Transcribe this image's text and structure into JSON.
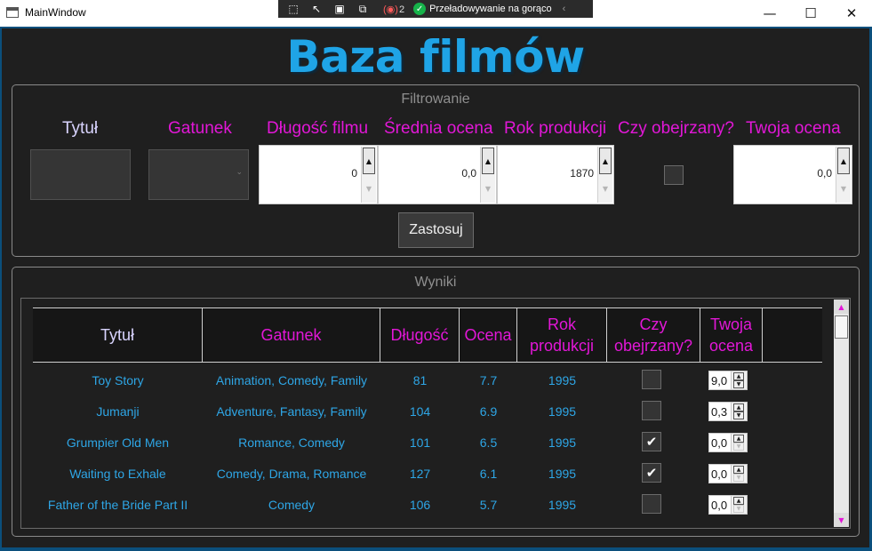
{
  "window": {
    "title": "MainWindow",
    "minimize": "—",
    "maximize": "☐",
    "close": "✕"
  },
  "debug_toolbar": {
    "badge": "(◉)",
    "badge_count": "2",
    "reload_label": "Przeładowywanie na gorąco",
    "collapse": "‹"
  },
  "page": {
    "title": "Baza filmów"
  },
  "filters": {
    "header": "Filtrowanie",
    "labels": {
      "title": "Tytuł",
      "genre": "Gatunek",
      "length": "Długość filmu",
      "avg_rating": "Średnia ocena",
      "year": "Rok produkcji",
      "watched": "Czy obejrzany?",
      "my_rating": "Twoja ocena"
    },
    "values": {
      "title": "",
      "genre": "",
      "length": "0",
      "avg_rating": "0,0",
      "year": "1870",
      "watched": false,
      "my_rating": "0,0"
    },
    "apply_label": "Zastosuj"
  },
  "results": {
    "header": "Wyniki",
    "columns": {
      "title": "Tytuł",
      "genre": "Gatunek",
      "length": "Długość",
      "rating": "Ocena",
      "year_l1": "Rok",
      "year_l2": "produkcji",
      "watched_l1": "Czy",
      "watched_l2": "obejrzany?",
      "my_l1": "Twoja",
      "my_l2": "ocena"
    },
    "rows": [
      {
        "title": "Toy Story",
        "genre": "Animation, Comedy, Family",
        "length": "81",
        "rating": "7.7",
        "year": "1995",
        "watched": "",
        "my_rating": "9,0"
      },
      {
        "title": "Jumanji",
        "genre": "Adventure, Fantasy, Family",
        "length": "104",
        "rating": "6.9",
        "year": "1995",
        "watched": "",
        "my_rating": "0,3"
      },
      {
        "title": "Grumpier Old Men",
        "genre": "Romance, Comedy",
        "length": "101",
        "rating": "6.5",
        "year": "1995",
        "watched": "✔",
        "my_rating": "0,0"
      },
      {
        "title": "Waiting to Exhale",
        "genre": "Comedy, Drama, Romance",
        "length": "127",
        "rating": "6.1",
        "year": "1995",
        "watched": "✔",
        "my_rating": "0,0"
      },
      {
        "title": "Father of the Bride Part II",
        "genre": "Comedy",
        "length": "106",
        "rating": "5.7",
        "year": "1995",
        "watched": "",
        "my_rating": "0,0"
      }
    ]
  },
  "colors": {
    "accent_blue": "#1fa4e6",
    "magenta": "#e217d7",
    "lavender": "#d9d4ff",
    "background": "#1f1f1f"
  }
}
